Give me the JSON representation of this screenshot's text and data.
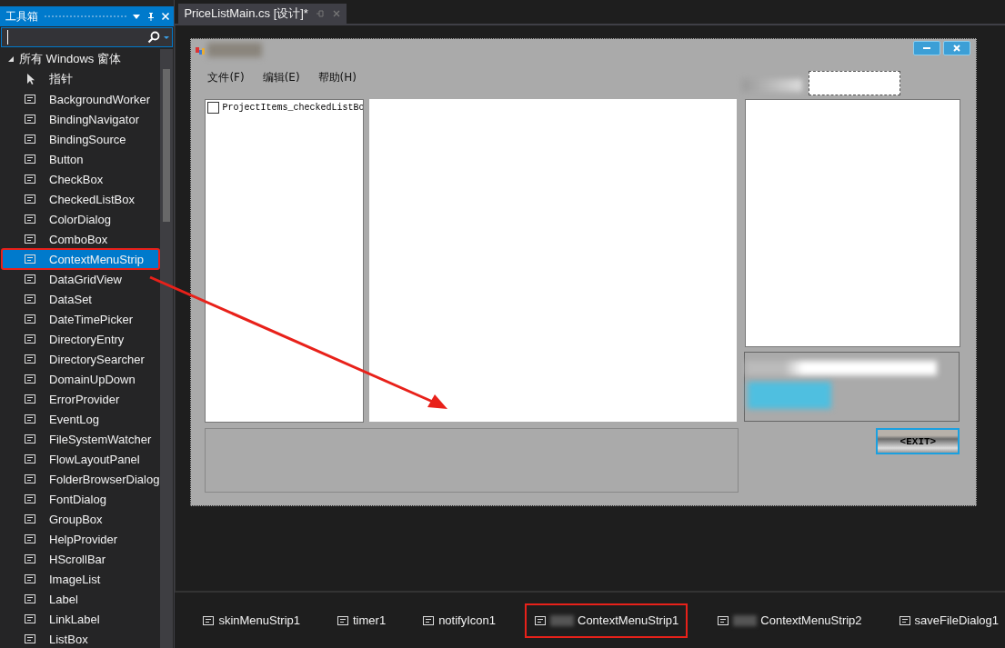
{
  "toolbox": {
    "title": "工具箱",
    "category": {
      "label": "所有 Windows 窗体",
      "expanded": true
    },
    "items": [
      {
        "label": "指针",
        "selected": false,
        "highlighted": false
      },
      {
        "label": "BackgroundWorker",
        "selected": false,
        "highlighted": false
      },
      {
        "label": "BindingNavigator",
        "selected": false,
        "highlighted": false
      },
      {
        "label": "BindingSource",
        "selected": false,
        "highlighted": false
      },
      {
        "label": "Button",
        "selected": false,
        "highlighted": false
      },
      {
        "label": "CheckBox",
        "selected": false,
        "highlighted": false
      },
      {
        "label": "CheckedListBox",
        "selected": false,
        "highlighted": false
      },
      {
        "label": "ColorDialog",
        "selected": false,
        "highlighted": false
      },
      {
        "label": "ComboBox",
        "selected": false,
        "highlighted": false
      },
      {
        "label": "ContextMenuStrip",
        "selected": true,
        "highlighted": true
      },
      {
        "label": "DataGridView",
        "selected": false,
        "highlighted": false
      },
      {
        "label": "DataSet",
        "selected": false,
        "highlighted": false
      },
      {
        "label": "DateTimePicker",
        "selected": false,
        "highlighted": false
      },
      {
        "label": "DirectoryEntry",
        "selected": false,
        "highlighted": false
      },
      {
        "label": "DirectorySearcher",
        "selected": false,
        "highlighted": false
      },
      {
        "label": "DomainUpDown",
        "selected": false,
        "highlighted": false
      },
      {
        "label": "ErrorProvider",
        "selected": false,
        "highlighted": false
      },
      {
        "label": "EventLog",
        "selected": false,
        "highlighted": false
      },
      {
        "label": "FileSystemWatcher",
        "selected": false,
        "highlighted": false
      },
      {
        "label": "FlowLayoutPanel",
        "selected": false,
        "highlighted": false
      },
      {
        "label": "FolderBrowserDialog",
        "selected": false,
        "highlighted": false
      },
      {
        "label": "FontDialog",
        "selected": false,
        "highlighted": false
      },
      {
        "label": "GroupBox",
        "selected": false,
        "highlighted": false
      },
      {
        "label": "HelpProvider",
        "selected": false,
        "highlighted": false
      },
      {
        "label": "HScrollBar",
        "selected": false,
        "highlighted": false
      },
      {
        "label": "ImageList",
        "selected": false,
        "highlighted": false
      },
      {
        "label": "Label",
        "selected": false,
        "highlighted": false
      },
      {
        "label": "LinkLabel",
        "selected": false,
        "highlighted": false
      },
      {
        "label": "ListBox",
        "selected": false,
        "highlighted": false
      }
    ]
  },
  "document_tab": {
    "label": "PriceListMain.cs [设计]*",
    "selected": true
  },
  "form": {
    "menu": [
      "文件(F)",
      "编辑(E)",
      "帮助(H)"
    ],
    "checked_list": {
      "label": "ProjectItems_checkedListBo",
      "checked": false
    },
    "exit_button": "<EXIT>"
  },
  "tray": [
    {
      "label": "skinMenuStrip1",
      "highlighted": false
    },
    {
      "label": "timer1",
      "highlighted": false
    },
    {
      "label": "notifyIcon1",
      "highlighted": false
    },
    {
      "label": "ContextMenuStrip1",
      "highlighted": true,
      "blurred_prefix": true
    },
    {
      "label": "ContextMenuStrip2",
      "highlighted": false,
      "blurred_prefix": true
    },
    {
      "label": "saveFileDialog1",
      "highlighted": false
    }
  ]
}
